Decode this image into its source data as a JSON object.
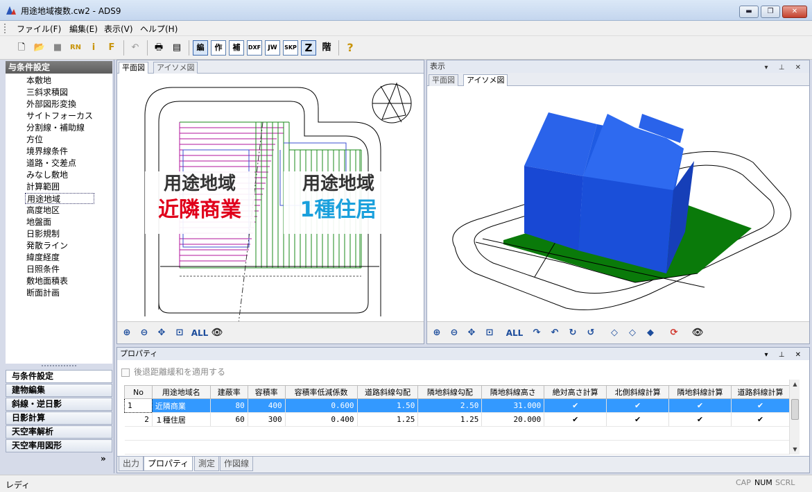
{
  "window": {
    "title": "用途地域複数.cw2 - ADS9",
    "buttons": {
      "minimize": "▬",
      "restore": "❐",
      "close": "✕"
    }
  },
  "menu": [
    "ファイル(F)",
    "編集(E)",
    "表示(V)",
    "ヘルプ(H)"
  ],
  "toolbar": {
    "new": "🗋",
    "open": "📂",
    "save": "■",
    "rn": "RN",
    "info": "i",
    "f": "F",
    "undo": "↶",
    "print": "🖶",
    "preview": "▤",
    "edit": "編",
    "make": "作",
    "aux": "補",
    "dxf": "DXF",
    "jw": "JW",
    "skp": "SKP",
    "z": "Z",
    "floor": "階",
    "help": "?"
  },
  "left_panel": {
    "header": "与条件設定",
    "tree": [
      "本敷地",
      "三斜求積図",
      "外部図形変換",
      "サイトフォーカス",
      "分割線・補助線",
      "方位",
      "境界線条件",
      "道路・交差点",
      "みなし敷地",
      "計算範囲",
      "用途地域",
      "高度地区",
      "地盤面",
      "日影規制",
      "発散ライン",
      "緯度経度",
      "日照条件",
      "敷地面積表",
      "断面計画"
    ],
    "selected_index": 10,
    "nav": [
      "与条件設定",
      "建物編集",
      "斜線・逆日影",
      "日影計算",
      "天空率解析",
      "天空率用図形"
    ],
    "more": "»"
  },
  "plan": {
    "tabs": [
      "平面図",
      "アイソメ図"
    ],
    "zone_left": {
      "title": "用途地域",
      "type": "近隣商業",
      "color": "#e0001b"
    },
    "zone_right": {
      "title": "用途地域",
      "type": "1種住居",
      "color": "#1aa0dc"
    },
    "tools": {
      "zoom_in": "⊕",
      "zoom_out": "⊖",
      "pan": "✥",
      "fit": "⊡",
      "all": "ALL",
      "eye": "👁"
    }
  },
  "display": {
    "header": "表示",
    "pins": "▾ ⊥ ✕",
    "tabs": [
      "平面図",
      "アイソメ図"
    ],
    "colors": {
      "building": "#1f5be3",
      "ground": "#0a7a0a"
    },
    "tools": [
      "⊕",
      "⊖",
      "✥",
      "⊡",
      "ALL",
      "↷",
      "↶",
      "↻",
      "↺",
      "◇",
      "◇",
      "◆",
      "⟳",
      "👁"
    ]
  },
  "properties": {
    "header": "プロパティ",
    "pins": "▾ ⊥ ✕",
    "checkbox_label": "後退距離緩和を適用する",
    "columns": [
      "No",
      "用途地域名",
      "建蔽率",
      "容積率",
      "容積率低減係数",
      "道路斜線勾配",
      "隣地斜線勾配",
      "隣地斜線高さ",
      "絶対高さ計算",
      "北側斜線計算",
      "隣地斜線計算",
      "道路斜線計算"
    ],
    "rows": [
      {
        "no": "1",
        "name": "近隣商業",
        "coverage": "80",
        "far": "400",
        "coef": "0.600",
        "road": "1.50",
        "adj": "2.50",
        "adjh": "31.000",
        "c1": "✔",
        "c2": "✔",
        "c3": "✔",
        "c4": "✔"
      },
      {
        "no": "2",
        "name": "１種住居",
        "coverage": "60",
        "far": "300",
        "coef": "0.400",
        "road": "1.25",
        "adj": "1.25",
        "adjh": "20.000",
        "c1": "✔",
        "c2": "✔",
        "c3": "✔",
        "c4": "✔"
      }
    ],
    "bottom_tabs": [
      "出力",
      "プロパティ",
      "測定",
      "作図線"
    ]
  },
  "status": {
    "text": "レディ",
    "indicators": [
      "CAP",
      "NUM",
      "SCRL"
    ]
  }
}
